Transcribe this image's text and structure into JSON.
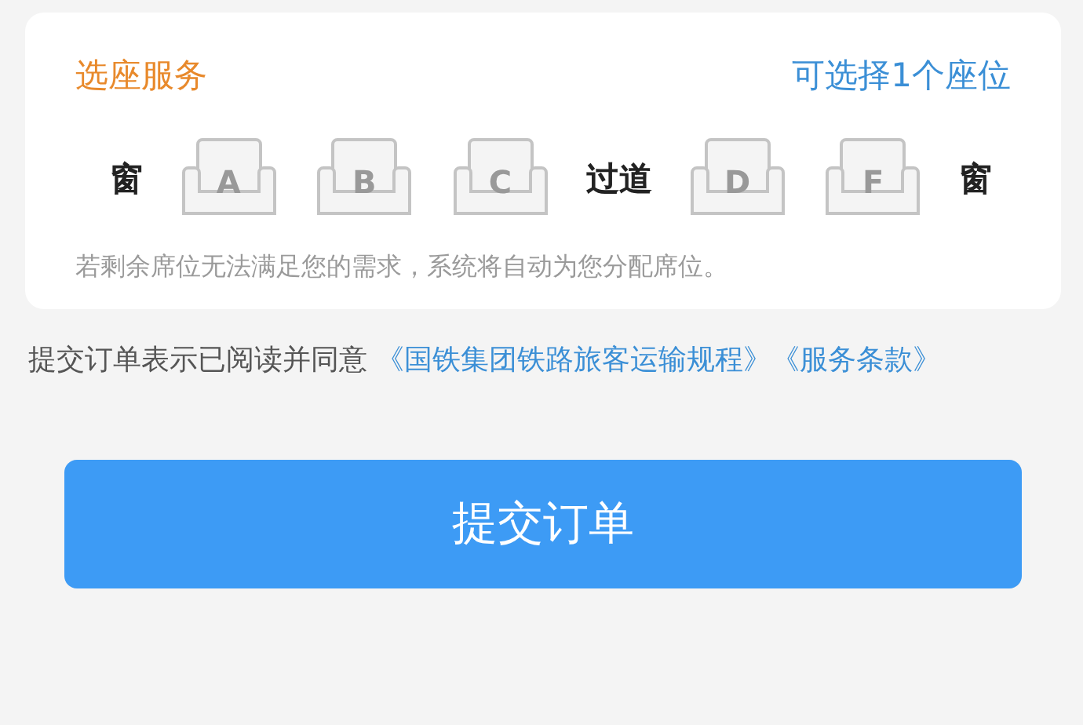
{
  "seat_card": {
    "title": "选座服务",
    "hint": "可选择1个座位",
    "seats": [
      {
        "kind": "label",
        "text": "窗"
      },
      {
        "kind": "seat",
        "text": "A",
        "selected": false
      },
      {
        "kind": "seat",
        "text": "B",
        "selected": false
      },
      {
        "kind": "seat",
        "text": "C",
        "selected": false
      },
      {
        "kind": "label",
        "text": "过道"
      },
      {
        "kind": "seat",
        "text": "D",
        "selected": false
      },
      {
        "kind": "seat",
        "text": "F",
        "selected": false
      },
      {
        "kind": "label",
        "text": "窗"
      }
    ],
    "note": "若剩余席位无法满足您的需求，系统将自动为您分配席位。"
  },
  "agreement": {
    "text": "提交订单表示已阅读并同意",
    "links": [
      "《国铁集团铁路旅客运输规程》",
      "《服务条款》"
    ]
  },
  "submit_button": "提交订单"
}
